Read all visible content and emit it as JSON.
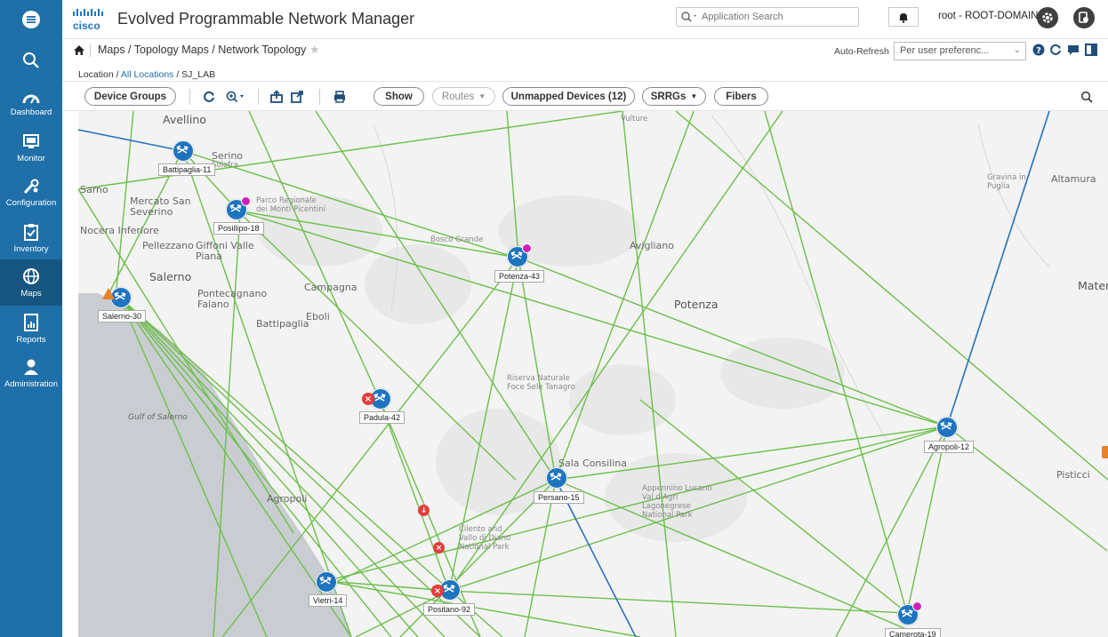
{
  "app": {
    "title": "Evolved Programmable Network Manager",
    "brand_text": "cisco",
    "search_placeholder": "Application Search",
    "user": "root - ROOT-DOMAIN"
  },
  "leftnav": {
    "items": [
      {
        "label": "Dashboard",
        "icon": "speedometer-icon"
      },
      {
        "label": "Monitor",
        "icon": "monitor-icon"
      },
      {
        "label": "Configuration",
        "icon": "wrench-icon"
      },
      {
        "label": "Inventory",
        "icon": "clipboard-icon"
      },
      {
        "label": "Maps",
        "icon": "globe-icon",
        "active": true
      },
      {
        "label": "Reports",
        "icon": "report-icon"
      },
      {
        "label": "Administration",
        "icon": "person-icon"
      }
    ]
  },
  "breadcrumb": {
    "path": "Maps / Topology Maps / Network Topology",
    "auto_refresh_label": "Auto-Refresh",
    "auto_refresh_value": "Per user preferenc..."
  },
  "location": {
    "prefix": "Location / ",
    "all": "All Locations",
    "rest": " / SJ_LAB"
  },
  "toolbar": {
    "device_groups": "Device Groups",
    "show": "Show",
    "routes": "Routes",
    "unmapped": "Unmapped Devices (12)",
    "srrgs": "SRRGs",
    "fibers": "Fibers"
  },
  "map": {
    "places": [
      {
        "name": "Avellino",
        "size": "big"
      },
      {
        "name": "Serino",
        "size": "normal"
      },
      {
        "name": "Solofra",
        "size": "normal"
      },
      {
        "name": "Sarno",
        "size": "normal"
      },
      {
        "name": "Mercato San Severino",
        "size": "normal"
      },
      {
        "name": "Nocera Inferiore",
        "size": "normal"
      },
      {
        "name": "Pellezzano",
        "size": "normal"
      },
      {
        "name": "Giffoni Valle Piana",
        "size": "normal"
      },
      {
        "name": "Salerno",
        "size": "big"
      },
      {
        "name": "Pontecagnano Faiano",
        "size": "normal"
      },
      {
        "name": "Battipaglia",
        "size": "normal"
      },
      {
        "name": "Eboli",
        "size": "normal"
      },
      {
        "name": "Campagna",
        "size": "normal"
      },
      {
        "name": "Gulf of Salerno",
        "size": "normal"
      },
      {
        "name": "Agropoli",
        "size": "normal"
      },
      {
        "name": "Parco Regionale dei Monti Picentini",
        "size": "small"
      },
      {
        "name": "Bosco Grande",
        "size": "small"
      },
      {
        "name": "Vulture",
        "size": "small"
      },
      {
        "name": "Avigliano",
        "size": "normal"
      },
      {
        "name": "Potenza",
        "size": "big"
      },
      {
        "name": "Riserva Naturale Foce Sele Tanagro",
        "size": "small"
      },
      {
        "name": "Sala Consilina",
        "size": "normal"
      },
      {
        "name": "Appennino Lucano Val d'Agri Lagonegrese National Park",
        "size": "small"
      },
      {
        "name": "Cilento and Vallo di Diano National Park",
        "size": "small"
      },
      {
        "name": "Gravina in Puglia",
        "size": "small"
      },
      {
        "name": "Altamura",
        "size": "normal"
      },
      {
        "name": "Matera",
        "size": "big"
      },
      {
        "name": "Pisticci",
        "size": "normal"
      }
    ],
    "devices": [
      {
        "name": "Battipaglia-11",
        "status": "ok"
      },
      {
        "name": "Posillipo-18",
        "status": "ok",
        "badge": "pink"
      },
      {
        "name": "Potenza-43",
        "status": "ok",
        "badge": "pink"
      },
      {
        "name": "Salerno-30",
        "status": "warning"
      },
      {
        "name": "Padula-42",
        "status": "down"
      },
      {
        "name": "Persano-15",
        "status": "ok"
      },
      {
        "name": "Agropoli-12",
        "status": "ok"
      },
      {
        "name": "Vietri-14",
        "status": "ok"
      },
      {
        "name": "Positano-92",
        "status": "down"
      },
      {
        "name": "Camerota-19",
        "status": "ok",
        "badge": "pink"
      }
    ]
  },
  "colors": {
    "nav_bg": "#1f6fa8",
    "node": "#1f74c0",
    "link_green": "#6cbf4a",
    "link_blue": "#2a74c0",
    "error": "#e33d3d"
  }
}
